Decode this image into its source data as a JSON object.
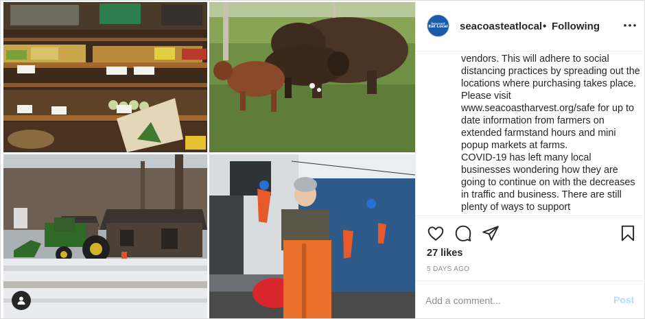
{
  "header": {
    "username": "seacoasteatlocal",
    "separator": "•",
    "follow_status": "Following",
    "avatar_text_top": "Seacoast",
    "avatar_text_main": "Eat Local",
    "more_glyph": "•••"
  },
  "caption": {
    "lines": [
      "vendors. This will adhere to social distancing practices by spreading out the locations where purchasing takes place. Please visit www.seacoastharvest.org/safe for up to date information from farmers on extended farmstand hours and mini popup markets at farms.",
      "COVID-19 has left many local businesses wondering how they are going to continue on with the decreases in traffic and business. There are still plenty of ways to support"
    ]
  },
  "actions": {
    "like_icon": "heart-icon",
    "comment_icon": "comment-icon",
    "share_icon": "share-icon",
    "save_icon": "bookmark-icon"
  },
  "stats": {
    "likes": "27 likes",
    "posted": "5 DAYS AGO"
  },
  "comment": {
    "placeholder": "Add a comment...",
    "post_label": "Post"
  },
  "collage": {
    "tiles": [
      "farmstand-produce-photo",
      "bison-pasture-photo",
      "snowy-farm-tractor-photo",
      "fisherman-boat-photo"
    ],
    "tag_icon": "user-tag-icon"
  },
  "colors": {
    "brand": "#1d5aa8",
    "post_disabled": "#b3dbff",
    "muted": "#8e8e8e",
    "text": "#262626"
  }
}
